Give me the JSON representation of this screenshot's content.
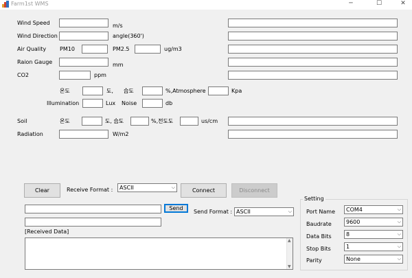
{
  "window": {
    "title": "Farm1st WMS"
  },
  "sensors": {
    "wind_speed": {
      "label": "Wind Speed",
      "unit": "m/s"
    },
    "wind_direction": {
      "label": "Wind Direction",
      "unit": "angle(360')"
    },
    "air_quality": {
      "label": "Air Quality",
      "pm10": "PM10",
      "pm25": "PM2.5",
      "unit": "ug/m3"
    },
    "rain_gauge": {
      "label": "Raion Gauge",
      "unit": "mm"
    },
    "co2": {
      "label": "CO2",
      "unit": "ppm"
    },
    "env": {
      "temp_label": "온도",
      "temp_unit": "도,",
      "humidity_label": "습도",
      "humidity_unit": "%,Atmosphere",
      "pressure_unit": "Kpa",
      "illumination_label": "Illumination",
      "illumination_unit": "Lux",
      "noise_label": "Noise",
      "noise_unit": "db"
    },
    "soil": {
      "label": "Soil",
      "temp_label": "온도",
      "temp_unit": "도, 습도",
      "humidity_unit": "%,전도도",
      "ec_unit": "us/cm"
    },
    "radiation": {
      "label": "Radiation",
      "unit": "W/m2"
    }
  },
  "comm": {
    "clear_label": "Clear",
    "receive_format_label": "Receive Format :",
    "receive_format_value": "ASCII",
    "connect_label": "Connect",
    "disconnect_label": "Disconnect",
    "send_label": "Send",
    "send_format_label": "Send Format :",
    "send_format_value": "ASCII",
    "received_data_label": "[Received Data]"
  },
  "setting": {
    "title": "Setting",
    "port_name_label": "Port Name",
    "port_name_value": "COM4",
    "baudrate_label": "Baudrate",
    "baudrate_value": "9600",
    "data_bits_label": "Data Bits",
    "data_bits_value": "8",
    "stop_bits_label": "Stop Bits",
    "stop_bits_value": "1",
    "parity_label": "Parity",
    "parity_value": "None"
  },
  "icons": {
    "minimize": "─",
    "maximize": "☐",
    "close": "✕",
    "dropdown": "⌵"
  }
}
